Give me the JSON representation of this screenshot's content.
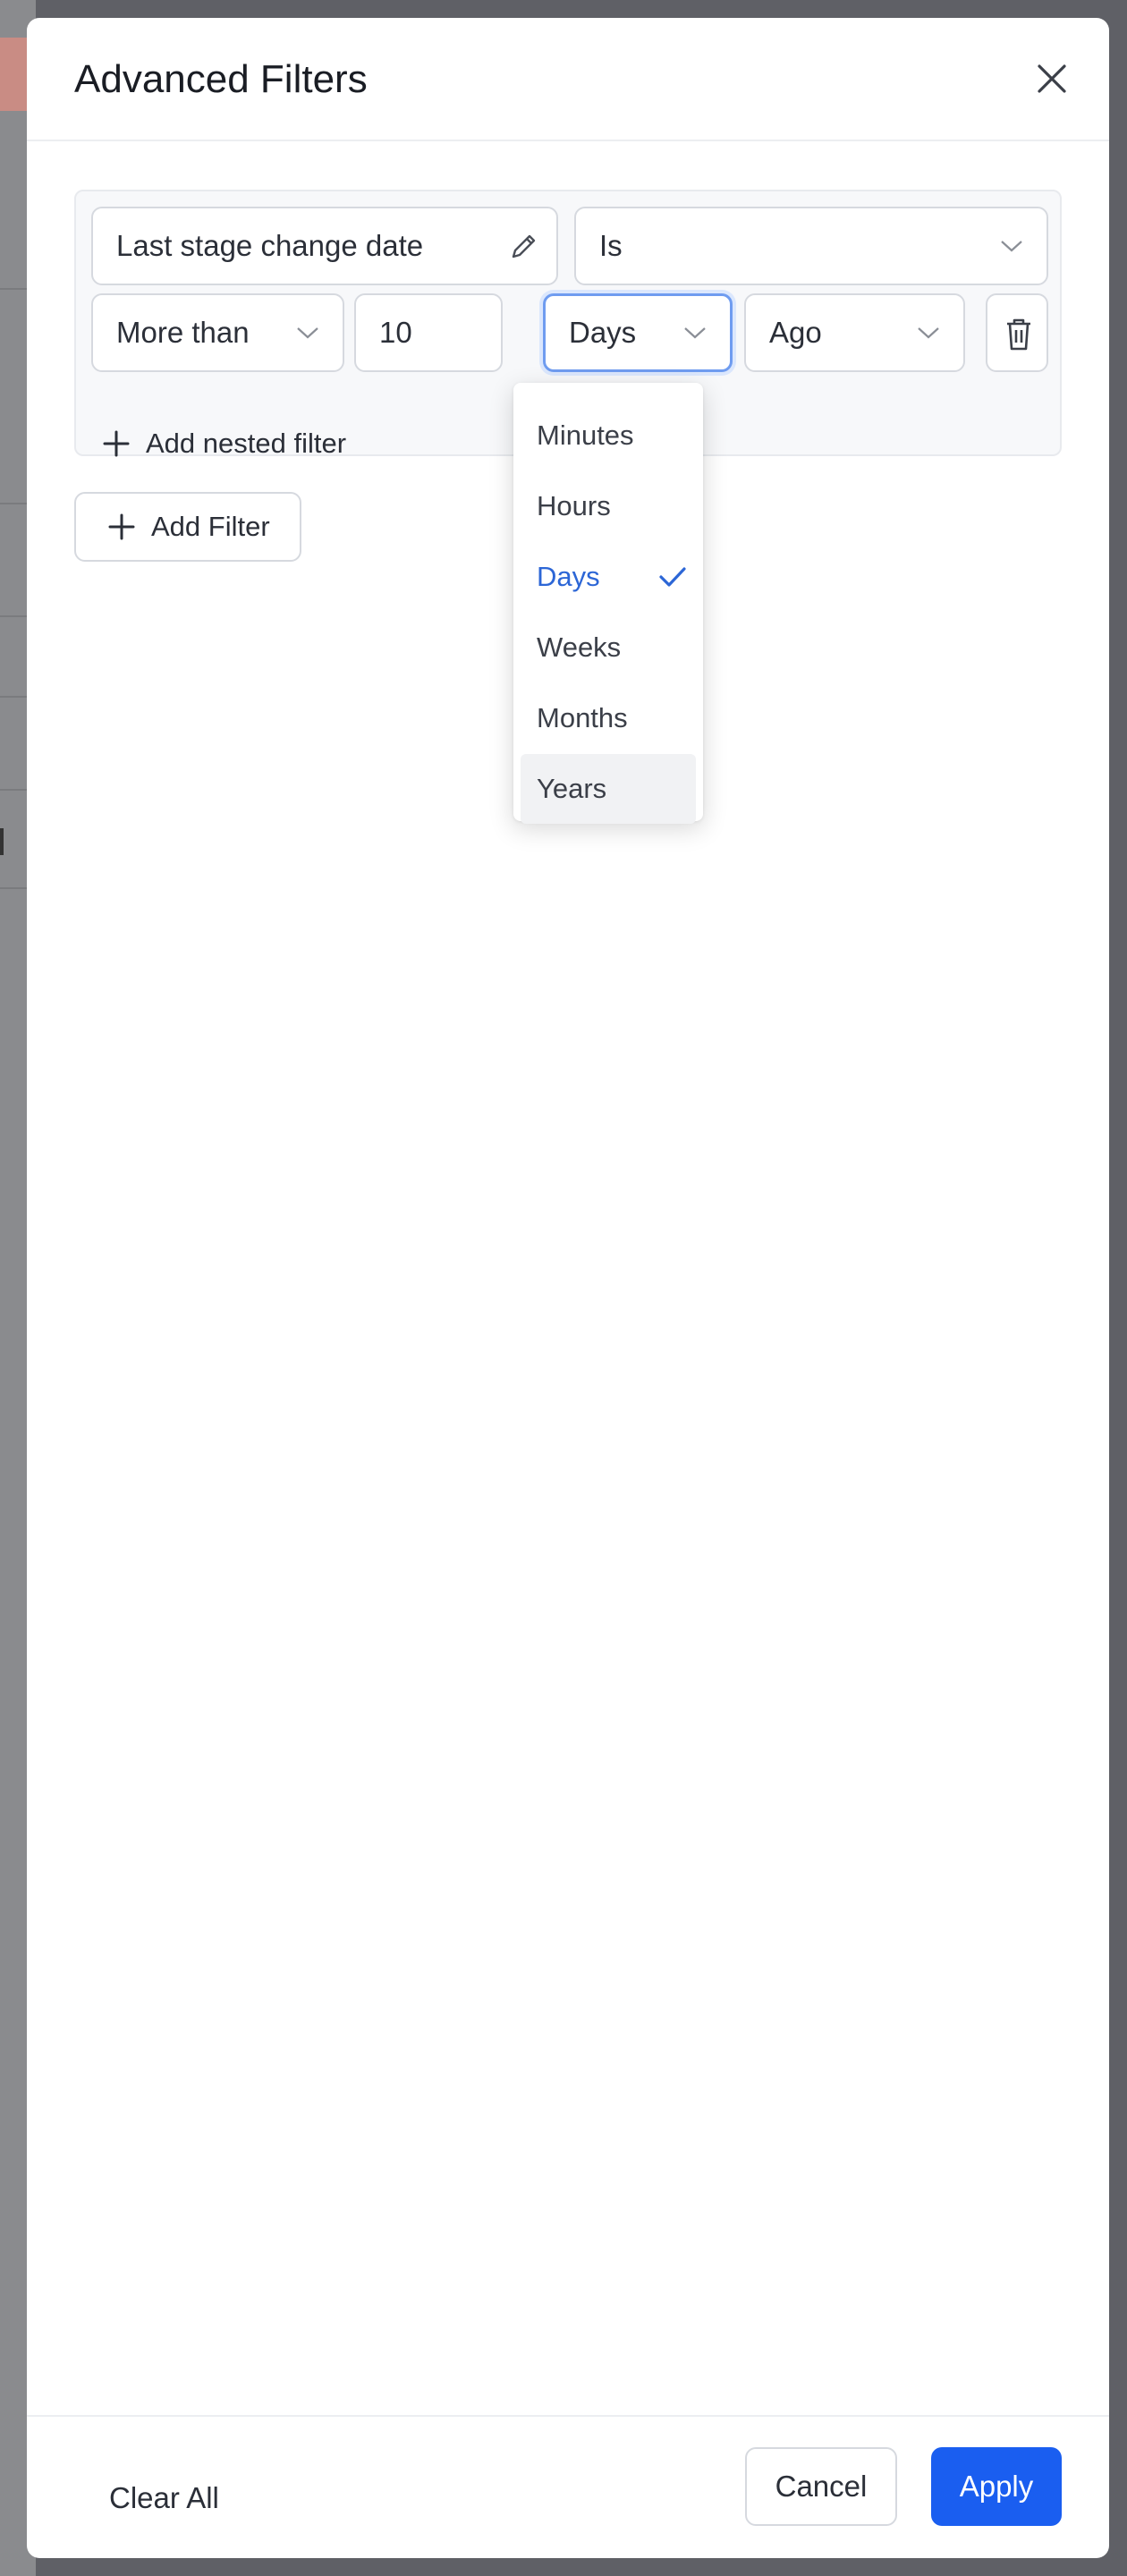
{
  "modal": {
    "title": "Advanced Filters"
  },
  "filter": {
    "field_label": "Last stage change date",
    "operator_value": "Is",
    "comparison_value": "More than",
    "amount_value": "10",
    "unit_value": "Days",
    "direction_value": "Ago",
    "add_nested_label": "Add nested filter"
  },
  "add_filter_label": "Add Filter",
  "unit_dropdown": {
    "options": [
      "Minutes",
      "Hours",
      "Days",
      "Weeks",
      "Months",
      "Years"
    ],
    "selected": "Days",
    "highlighted": "Years"
  },
  "footer": {
    "clear_all_label": "Clear All",
    "cancel_label": "Cancel",
    "apply_label": "Apply"
  },
  "colors": {
    "accent": "#1a5ef0",
    "selected_text": "#2c66d6",
    "overlay": "#5f6066"
  },
  "icons": {
    "close": "close-icon",
    "edit": "pencil-icon",
    "chevron": "chevron-down-icon",
    "delete": "trash-icon",
    "add": "plus-icon",
    "check": "check-icon"
  }
}
